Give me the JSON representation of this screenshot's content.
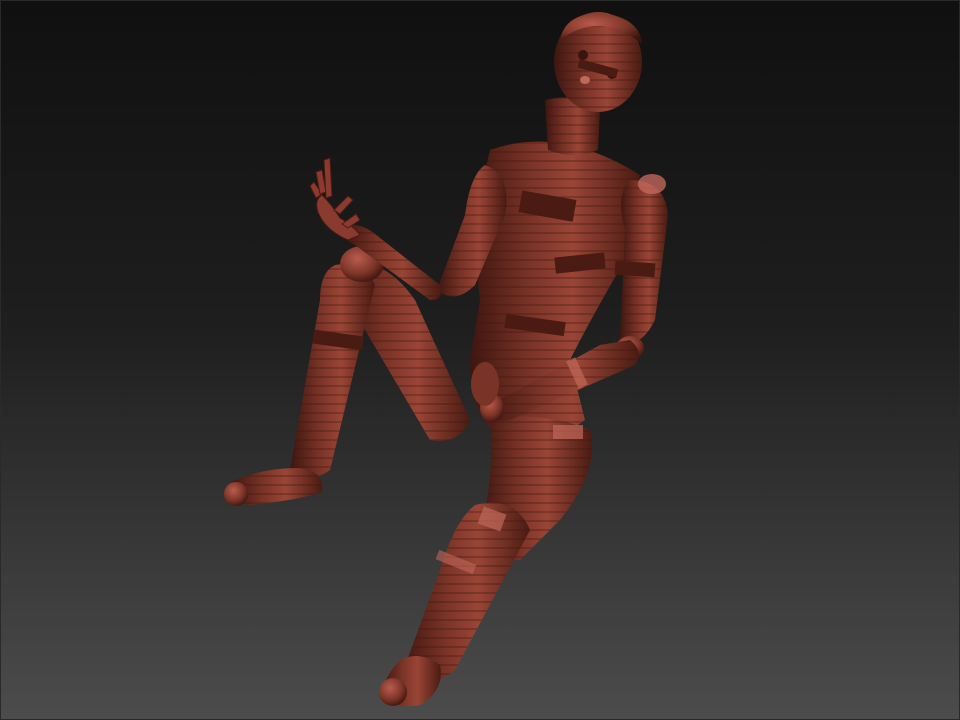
{
  "viewport": {
    "background_top": "#101010",
    "background_mid": "#1e1e1e",
    "background_bottom": "#4c4c4c",
    "border_color": "#2a2a2a"
  },
  "model": {
    "base_color": "#8a3a2f",
    "shade_color": "#3e1610",
    "highlight_color": "#c0685a",
    "band_color": "#5a2118"
  }
}
